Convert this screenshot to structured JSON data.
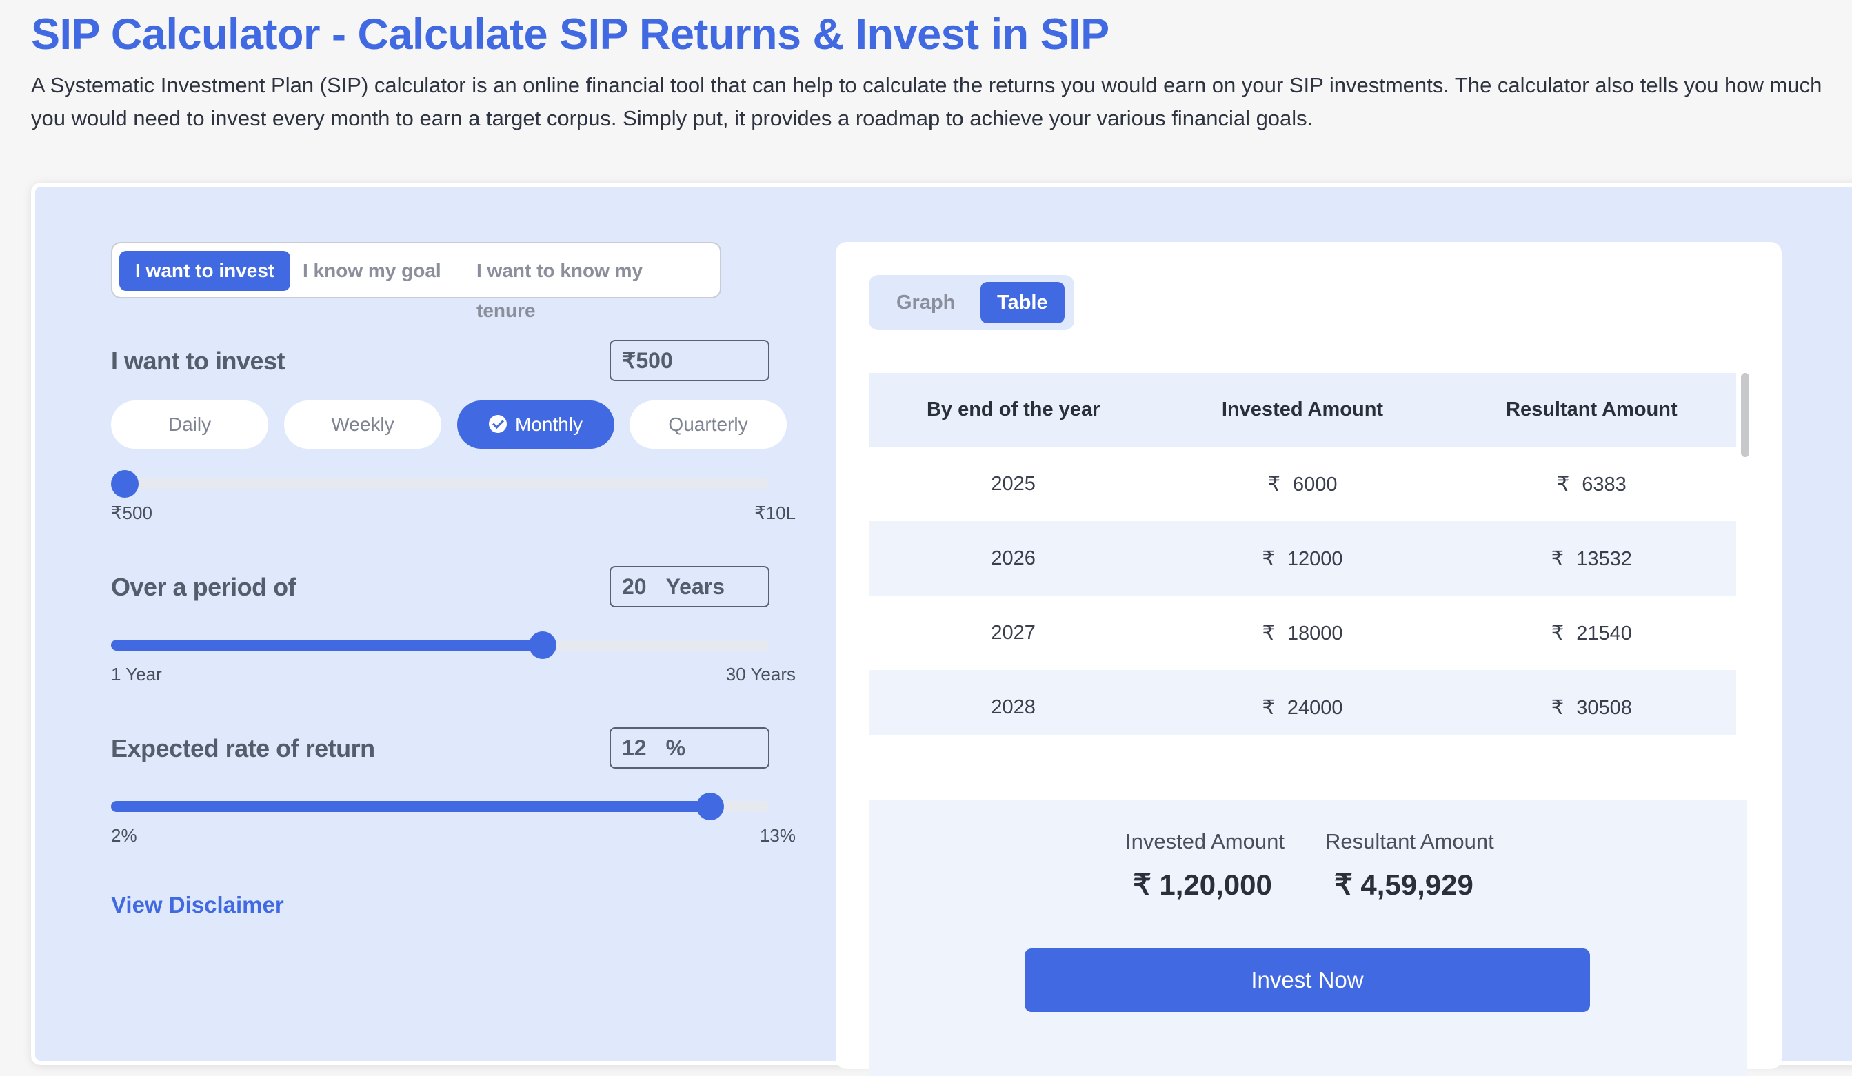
{
  "page": {
    "title": "SIP Calculator - Calculate SIP Returns & Invest in SIP",
    "description": "A Systematic Investment Plan (SIP) calculator is an online financial tool that can help to calculate the returns you would earn on your SIP investments. The calculator also tells you how much you would need to invest every month to earn a target corpus. Simply put, it provides a roadmap to achieve your various financial goals."
  },
  "calculator": {
    "mode_tabs": [
      {
        "label": "I want to invest",
        "active": true
      },
      {
        "label": "I know my goal",
        "active": false
      },
      {
        "label": "I want to know my tenure",
        "active": false
      }
    ],
    "invest": {
      "label": "I want to invest",
      "value": "₹500",
      "min_label": "₹500",
      "max_label": "₹10L",
      "slider_fraction": 0.0
    },
    "frequency": [
      {
        "label": "Daily",
        "active": false
      },
      {
        "label": "Weekly",
        "active": false
      },
      {
        "label": "Monthly",
        "active": true
      },
      {
        "label": "Quarterly",
        "active": false
      }
    ],
    "period": {
      "label": "Over a period of",
      "value": "20",
      "unit": "Years",
      "min_label": "1 Year",
      "max_label": "30 Years",
      "slider_fraction": 0.655
    },
    "rate": {
      "label": "Expected rate of return",
      "value": "12",
      "unit": "%",
      "min_label": "2%",
      "max_label": "13%",
      "slider_fraction": 0.91
    },
    "disclaimer_link": "View Disclaimer"
  },
  "results": {
    "view_tabs": [
      {
        "label": "Graph",
        "active": false
      },
      {
        "label": "Table",
        "active": true
      }
    ],
    "table": {
      "headers": [
        "By end of the year",
        "Invested Amount",
        "Resultant Amount"
      ],
      "currency": "₹",
      "rows": [
        {
          "year": "2025",
          "invested": "6000",
          "resultant": "6383"
        },
        {
          "year": "2026",
          "invested": "12000",
          "resultant": "13532"
        },
        {
          "year": "2027",
          "invested": "18000",
          "resultant": "21540"
        },
        {
          "year": "2028",
          "invested": "24000",
          "resultant": "30508"
        }
      ]
    },
    "summary": {
      "invested_label": "Invested Amount",
      "invested_value": "₹ 1,20,000",
      "resultant_label": "Resultant Amount",
      "resultant_value": "₹ 4,59,929"
    },
    "invest_button": "Invest Now"
  },
  "colors": {
    "accent": "#4169e1",
    "card_bg": "#dfe9fb",
    "page_bg": "#f6f6f7"
  }
}
